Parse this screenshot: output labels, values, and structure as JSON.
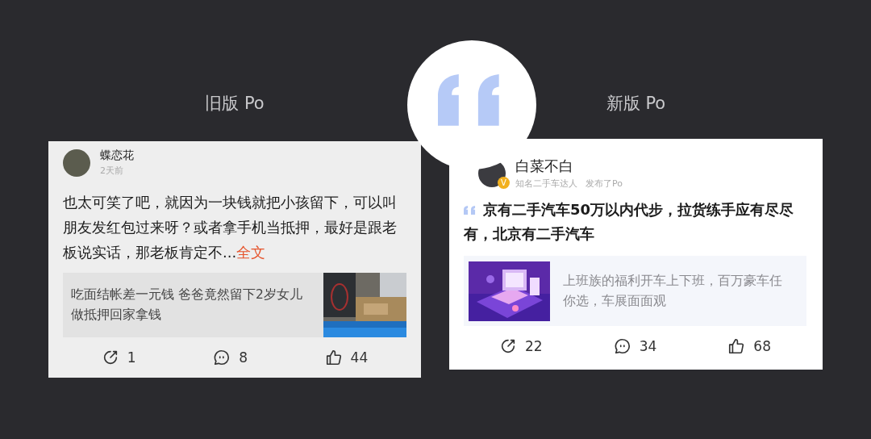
{
  "versions": [
    {
      "label": "旧版 Po",
      "post": {
        "author": "蝶恋花",
        "meta": [
          "2天前"
        ],
        "text": "也太可笑了吧，就因为一块钱就把小孩留下，可以叫朋友发红包过来呀？或者拿手机当抵押，最好是跟老板说实话，那老板肯定不...",
        "more": "全文",
        "link": {
          "title": "吃面结帐差一元钱 爸爸竟然留下2岁女儿做抵押回家拿钱"
        },
        "actions": [
          {
            "kind": "share",
            "count": "1"
          },
          {
            "kind": "comment",
            "count": "8"
          },
          {
            "kind": "like",
            "count": "44"
          }
        ]
      }
    },
    {
      "label": "新版 Po",
      "post": {
        "author": "白菜不白",
        "badge": "V",
        "meta": [
          "知名二手车达人",
          "发布了Po"
        ],
        "text": "京有二手汽车50万以内代步，拉货练手应有尽尽有，北京有二手汽车",
        "link": {
          "title": "上班族的福利开车上下班，百万豪车任你选，车展面面观"
        },
        "actions": [
          {
            "kind": "share",
            "count": "22"
          },
          {
            "kind": "comment",
            "count": "34"
          },
          {
            "kind": "like",
            "count": "68"
          }
        ]
      }
    }
  ]
}
